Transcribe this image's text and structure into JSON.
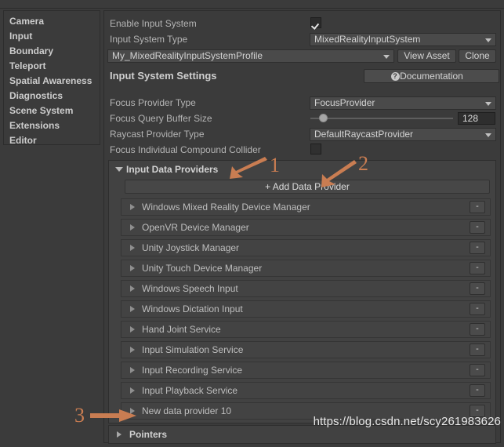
{
  "window": {
    "ghost_top_text": "",
    "watermark": "https://blog.csdn.net/scy261983626"
  },
  "colors": {
    "panel_bg": "#3b3b3b",
    "group_bg": "#424242",
    "row_bg": "#434343",
    "control_bg": "#4a4a4a",
    "text": "#b6b6b6",
    "annotation": "#c97d52"
  },
  "sidebar": {
    "items": [
      {
        "label": "Camera",
        "bold": true
      },
      {
        "label": "Input",
        "bold": true
      },
      {
        "label": "Boundary",
        "bold": true
      },
      {
        "label": "Teleport",
        "bold": true
      },
      {
        "label": "Spatial Awareness",
        "bold": true
      },
      {
        "label": "Diagnostics",
        "bold": true
      },
      {
        "label": "Scene System",
        "bold": true
      },
      {
        "label": "Extensions",
        "bold": true
      },
      {
        "label": "Editor",
        "bold": true
      }
    ]
  },
  "main": {
    "enable_input_system": {
      "label": "Enable Input System",
      "checked": true
    },
    "input_system_type": {
      "label": "Input System Type",
      "value": "MixedRealityInputSystem"
    },
    "profile": {
      "value": "My_MixedRealityInputSystemProfile",
      "view_asset_label": "View Asset",
      "clone_label": "Clone"
    },
    "settings_header": {
      "label": "Input System Settings",
      "documentation_label": "Documentation",
      "documentation_icon": "question-mark-icon"
    },
    "focus_provider_type": {
      "label": "Focus Provider Type",
      "value": "FocusProvider"
    },
    "focus_query_buffer_size": {
      "label": "Focus Query Buffer Size",
      "value": "128",
      "slider_percent": 9
    },
    "raycast_provider_type": {
      "label": "Raycast Provider Type",
      "value": "DefaultRaycastProvider"
    },
    "focus_individual_compound_collider": {
      "label": "Focus Individual Compound Collider",
      "checked": false
    },
    "input_data_providers": {
      "header": "Input Data Providers",
      "expanded": true,
      "add_button_label": "+ Add Data Provider",
      "remove_button_label": "-",
      "providers": [
        {
          "label": "Windows Mixed Reality Device Manager"
        },
        {
          "label": "OpenVR Device Manager"
        },
        {
          "label": "Unity Joystick Manager"
        },
        {
          "label": "Unity Touch Device Manager"
        },
        {
          "label": "Windows Speech Input"
        },
        {
          "label": "Windows Dictation Input"
        },
        {
          "label": "Hand Joint Service"
        },
        {
          "label": "Input Simulation Service"
        },
        {
          "label": "Input Recording Service"
        },
        {
          "label": "Input Playback Service"
        },
        {
          "label": "New data provider 10"
        }
      ]
    },
    "pointers": {
      "label": "Pointers",
      "expanded": false
    }
  },
  "annotations": [
    {
      "number": "1",
      "target": "input-data-providers-header"
    },
    {
      "number": "2",
      "target": "add-data-provider-button"
    },
    {
      "number": "3",
      "target": "new-data-provider-row"
    }
  ]
}
